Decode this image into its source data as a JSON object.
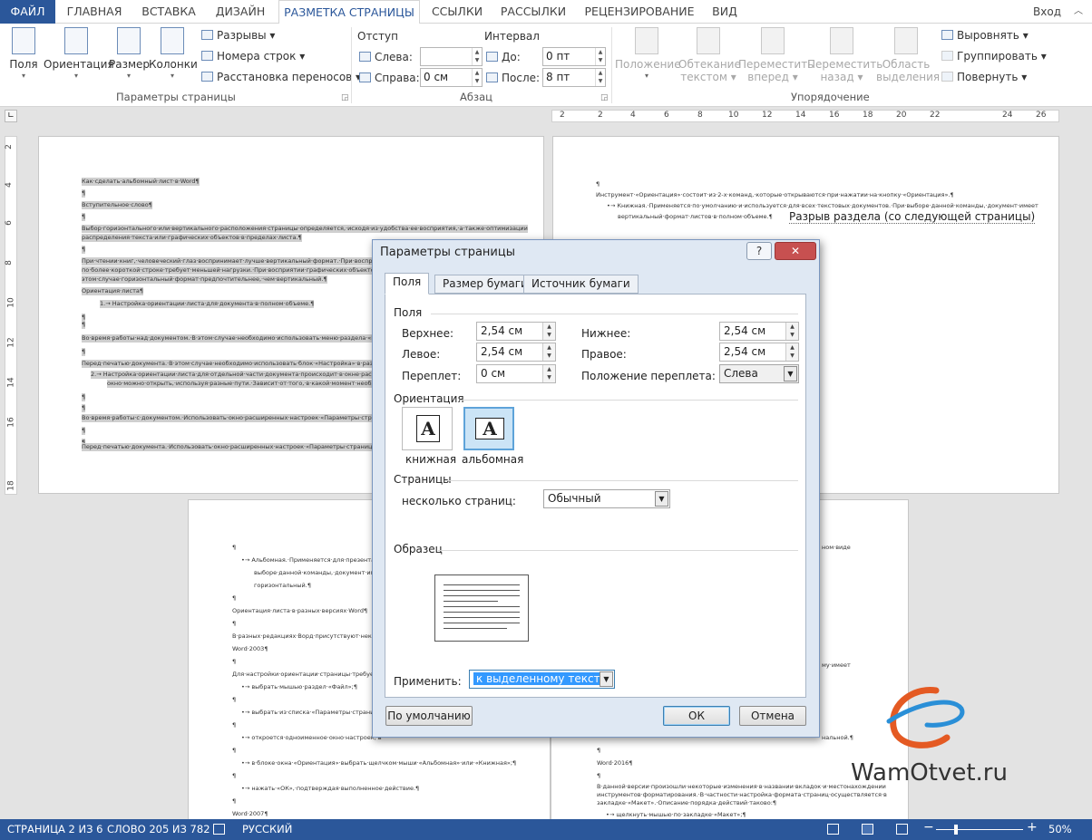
{
  "ribbon_tabs": [
    "ФАЙЛ",
    "ГЛАВНАЯ",
    "ВСТАВКА",
    "ДИЗАЙН",
    "РАЗМЕТКА СТРАНИЦЫ",
    "ССЫЛКИ",
    "РАССЫЛКИ",
    "РЕЦЕНЗИРОВАНИЕ",
    "ВИД"
  ],
  "account": {
    "signin_label": "Вход"
  },
  "ribbon": {
    "page_setup": {
      "margins": "Поля",
      "orientation": "Ориентация",
      "size": "Размер",
      "columns": "Колонки",
      "breaks": "Разрывы",
      "line_numbers": "Номера строк",
      "hyphenation": "Расстановка переносов",
      "group_label": "Параметры страницы"
    },
    "paragraph": {
      "indent_header": "Отступ",
      "spacing_header": "Интервал",
      "left_label": "Слева:",
      "left_value": "",
      "right_label": "Справа:",
      "right_value": "0 см",
      "before_label": "До:",
      "before_value": "0 пт",
      "after_label": "После:",
      "after_value": "8 пт",
      "group_label": "Абзац"
    },
    "arrange": {
      "position": [
        "Положение"
      ],
      "wrap": [
        "Обтекание",
        "текстом"
      ],
      "forward": [
        "Переместить",
        "вперед"
      ],
      "backward": [
        "Переместить",
        "назад"
      ],
      "selection": [
        "Область",
        "выделения"
      ],
      "align": "Выровнять",
      "group": "Группировать",
      "rotate": "Повернуть",
      "group_label": "Упорядочение"
    }
  },
  "ruler": {
    "h_ticks": [
      "2",
      "2",
      "4",
      "6",
      "8",
      "10",
      "12",
      "14",
      "16",
      "18",
      "20",
      "22",
      "24",
      "26"
    ],
    "v_ticks": [
      "2",
      "4",
      "6",
      "8",
      "10",
      "12",
      "14",
      "16",
      "18"
    ]
  },
  "document": {
    "left_page": [
      "Как·сделать·альбомный·лист·в·Word¶",
      "¶",
      "Вступительное·слово¶",
      "¶",
      "Выбор·горизонтального·или·вертикального·расположения·страницы·определяется,·исходя·из·удобства·ее·восприятия,·а·также·оптимизации",
      "распределения·текста·или·графических·объектов·в·пределах·листа.¶",
      "¶",
      "При·чтении·книг,·человеческий·глаз·воспринимает·лучше·вертикальный·формат.·При·восприятии·мел",
      "по·более·короткой·строке·требует·меньшей·нагрузки.·При·восприятии·графических·объектов·или·рису",
      "этом·случае·горизонтальный·формат·предпочтительнее,·чем·вертикальный.¶",
      "Ориентация·листа¶",
      "1.→ Настройка·ориентации·листа·для·документа·в·полном·объеме.¶",
      "¶",
      "¶",
      "Во·время·работы·над·документом.·В·этом·случае·необходимо·использовать·меню·раздела·«Разметка",
      "¶",
      "Перед·печатью·документа.·В·этом·случае·необходимо·использовать·блок·«Настройка»·в·разделе·«Пе",
      "2.→ Настройка·ориентации·листа·для·отдельной·части·документа·происходит·в·окне·расширенных",
      "окно·можно·открыть,·используя·разные·пути.·Зависит·от·того,·в·какой·момент·необходимо·вып",
      "¶",
      "¶",
      "Во·время·работы·с·документом.·Использовать·окно·расширенных·настроек·«Параметры·страницы»",
      "¶",
      "¶",
      "Перед·печатью·документа.·Использовать·окно·расширенных·настроек·«Параметры·страницы»·раздел"
    ],
    "right_page": [
      "¶",
      "Инструмент·«Ориентация»·состоит·из·2-х·команд,·которые·открываются·при·нажатии·на·кнопку·«Ориентация».¶",
      "•→ Книжная.·Применяется·по·умолчанию·и·используется·для·всех·текстовых·документов.·При·выборе·данной·команды,·документ·имеет",
      "вертикальный·формат·листов·в·полном·объеме.¶"
    ],
    "section_break": "Разрыв раздела (со следующей страницы)",
    "bottom_left_page": [
      "¶",
      "•→ Альбомная.·Применяется·для·презентаци",
      "выборе·данной·команды,·документ·имеет",
      "горизонтальный.¶",
      "¶",
      "Ориентация·листа·в·разных·версиях·Word¶",
      "¶",
      "В·разных·редакциях·Ворд·присутствуют·некоторы",
      "Word·2003¶",
      "¶",
      "Для·настройки·ориентации·страницы·требуется·в",
      "•→ выбрать·мышью·раздел·«Файл»;¶",
      "¶",
      "•→ выбрать·из·списка·«Параметры·страниц",
      "¶",
      "•→ откроется·одноименное·окно·настроек,·в",
      "¶",
      "•→ в·блоке·окна·«Ориентация»·выбрать·щелчком·мыши·«Альбомная»·или·«Книжная»;¶",
      "¶",
      "•→ нажать·«ОК»,·подтверждая·выполненное·действие.¶",
      "¶",
      "Word·2007¶",
      "¶"
    ],
    "bottom_right_page": [
      "ном·виде",
      "му·имеет",
      "нальной.¶",
      "¶",
      "Word·2016¶",
      "¶",
      "В·данной·версии·произошли·некоторые·изменения·в·названии·вкладок·и·местонахождении",
      "инструментов·форматирования.·В·частности·настройка·формата·страниц·осуществляется·в",
      "закладке·«Макет».·Описание·порядка·действий·таково:¶",
      "•→ щелкнуть·мышью·по·закладке·«Макет»;¶"
    ]
  },
  "dialog": {
    "title": "Параметры страницы",
    "help_label": "?",
    "close_label": "✕",
    "tabs": [
      "Поля",
      "Размер бумаги",
      "Источник бумаги"
    ],
    "margins_section": "Поля",
    "top_label": "Верхнее:",
    "top_value": "2,54 см",
    "bottom_label": "Нижнее:",
    "bottom_value": "2,54 см",
    "left_label": "Левое:",
    "left_value": "2,54 см",
    "right_label": "Правое:",
    "right_value": "2,54 см",
    "gutter_label": "Переплет:",
    "gutter_value": "0 см",
    "gutter_pos_label": "Положение переплета:",
    "gutter_pos_value": "Слева",
    "orientation_section": "Ориентация",
    "portrait_label": "книжная",
    "landscape_label": "альбомная",
    "pages_section": "Страницы",
    "multiple_pages_label": "несколько страниц:",
    "multiple_pages_value": "Обычный",
    "preview_section": "Образец",
    "apply_label": "Применить:",
    "apply_value": "к выделенному тексту",
    "default_button": "По умолчанию",
    "ok_button": "ОК",
    "cancel_button": "Отмена"
  },
  "logo_text": "WamOtvet.ru",
  "status": {
    "page": "СТРАНИЦА 2 ИЗ 6",
    "words": "СЛОВО 205 ИЗ 782",
    "language": "РУССКИЙ",
    "zoom": "50%"
  },
  "colors": {
    "accent": "#2b579a",
    "highlight": "#cfcfcf",
    "selection": "#3399ff"
  }
}
